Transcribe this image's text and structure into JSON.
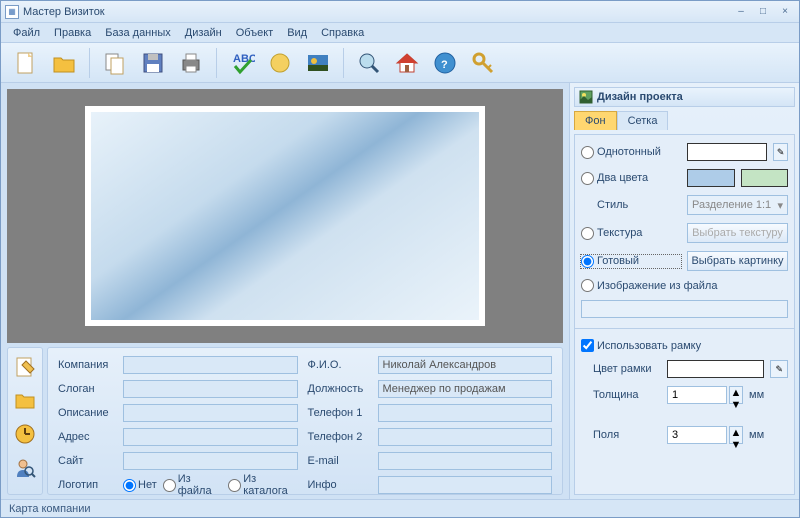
{
  "window": {
    "title": "Мастер Визиток"
  },
  "menu": [
    "Файл",
    "Правка",
    "База данных",
    "Дизайн",
    "Объект",
    "Вид",
    "Справка"
  ],
  "designPanel": {
    "title": "Дизайн проекта"
  },
  "tabs": {
    "bg": "Фон",
    "grid": "Сетка"
  },
  "bg": {
    "solid": "Однотонный",
    "twoColors": "Два цвета",
    "style": "Стиль",
    "styleValue": "Разделение 1:1",
    "texture": "Текстура",
    "textureBtn": "Выбрать текстуру",
    "preset": "Готовый",
    "presetBtn": "Выбрать картинку",
    "fromFile": "Изображение из файла",
    "colors": {
      "solid": "#ffffff",
      "c1": "#aecce8",
      "c2": "#c4e4c4"
    }
  },
  "frame": {
    "use": "Использовать рамку",
    "color": "Цвет рамки",
    "colorValue": "#ffffff",
    "thickness": "Толщина",
    "thicknessValue": "1",
    "margin": "Поля",
    "marginValue": "3",
    "unit": "мм"
  },
  "form": {
    "company": "Компания",
    "slogan": "Слоган",
    "desc": "Описание",
    "address": "Адрес",
    "site": "Сайт",
    "logo": "Логотип",
    "fio": "Ф.И.О.",
    "position": "Должность",
    "phone1": "Телефон 1",
    "phone2": "Телефон 2",
    "email": "E-mail",
    "info": "Инфо",
    "fioValue": "Николай Александров",
    "positionValue": "Менеджер по продажам",
    "logoOpts": {
      "none": "Нет",
      "file": "Из файла",
      "catalog": "Из каталога"
    }
  },
  "status": "Карта компании"
}
